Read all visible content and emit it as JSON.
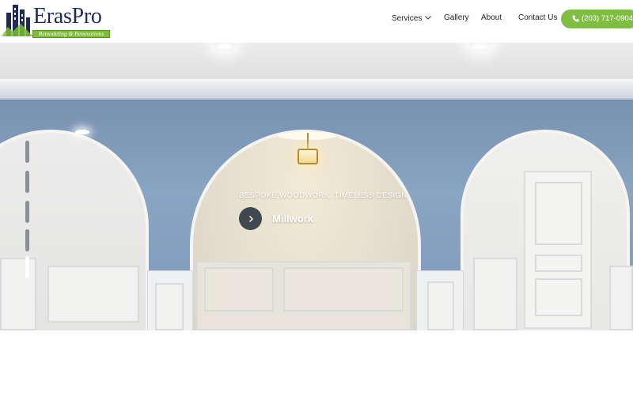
{
  "header": {
    "logo": {
      "name": "ErasPro",
      "tagline": "Remodeling & Renovations",
      "icon": "building-skyline-icon"
    },
    "nav": {
      "services_label": "Services",
      "services_icon": "chevron-down-icon",
      "gallery_label": "Gallery",
      "about_label": "About",
      "contact_label": "Contact Us"
    },
    "phone": {
      "label": "(203) 717-0904",
      "icon": "phone-icon"
    }
  },
  "hero": {
    "tagline": "BESPOKE WOODWORK, TIMELESS DESIGN",
    "title": "Millwork",
    "arrow_icon": "chevron-right-icon",
    "slides": {
      "count": 5,
      "active": 5
    }
  },
  "colors": {
    "accent": "#80be43",
    "brand_navy": "#1f2a55",
    "wall_blue": "#7d98b6"
  }
}
